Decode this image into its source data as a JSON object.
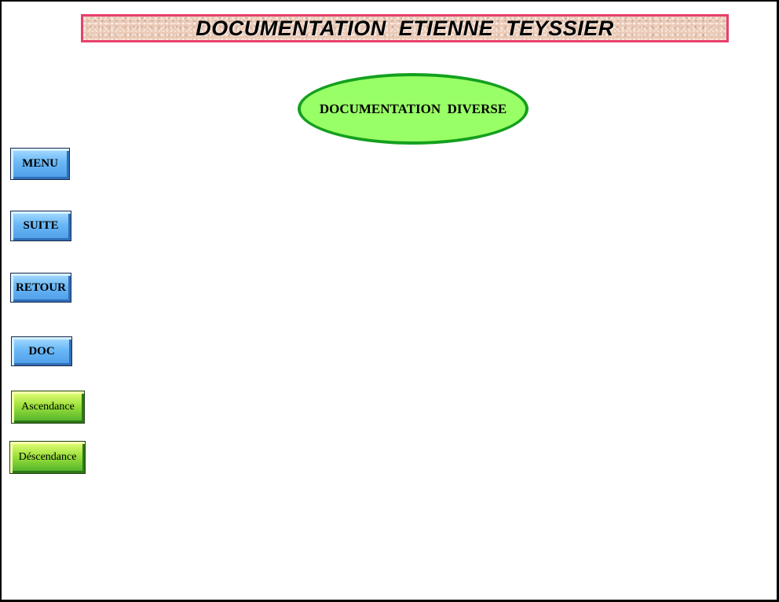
{
  "header": {
    "title": "DOCUMENTATION  ETIENNE  TEYSSIER"
  },
  "section": {
    "label": "DOCUMENTATION  DIVERSE"
  },
  "nav": {
    "menu_label": "MENU",
    "suite_label": "SUITE",
    "retour_label": "RETOUR",
    "doc_label": "DOC",
    "ascendance_label": "Ascendance",
    "descendance_label": "Déscendance"
  },
  "colors": {
    "banner_border": "#e8406c",
    "oval_fill": "#99ff66",
    "oval_border": "#14a01e",
    "blue_button": "#6ab8f6",
    "green_button": "#9ee23c"
  }
}
